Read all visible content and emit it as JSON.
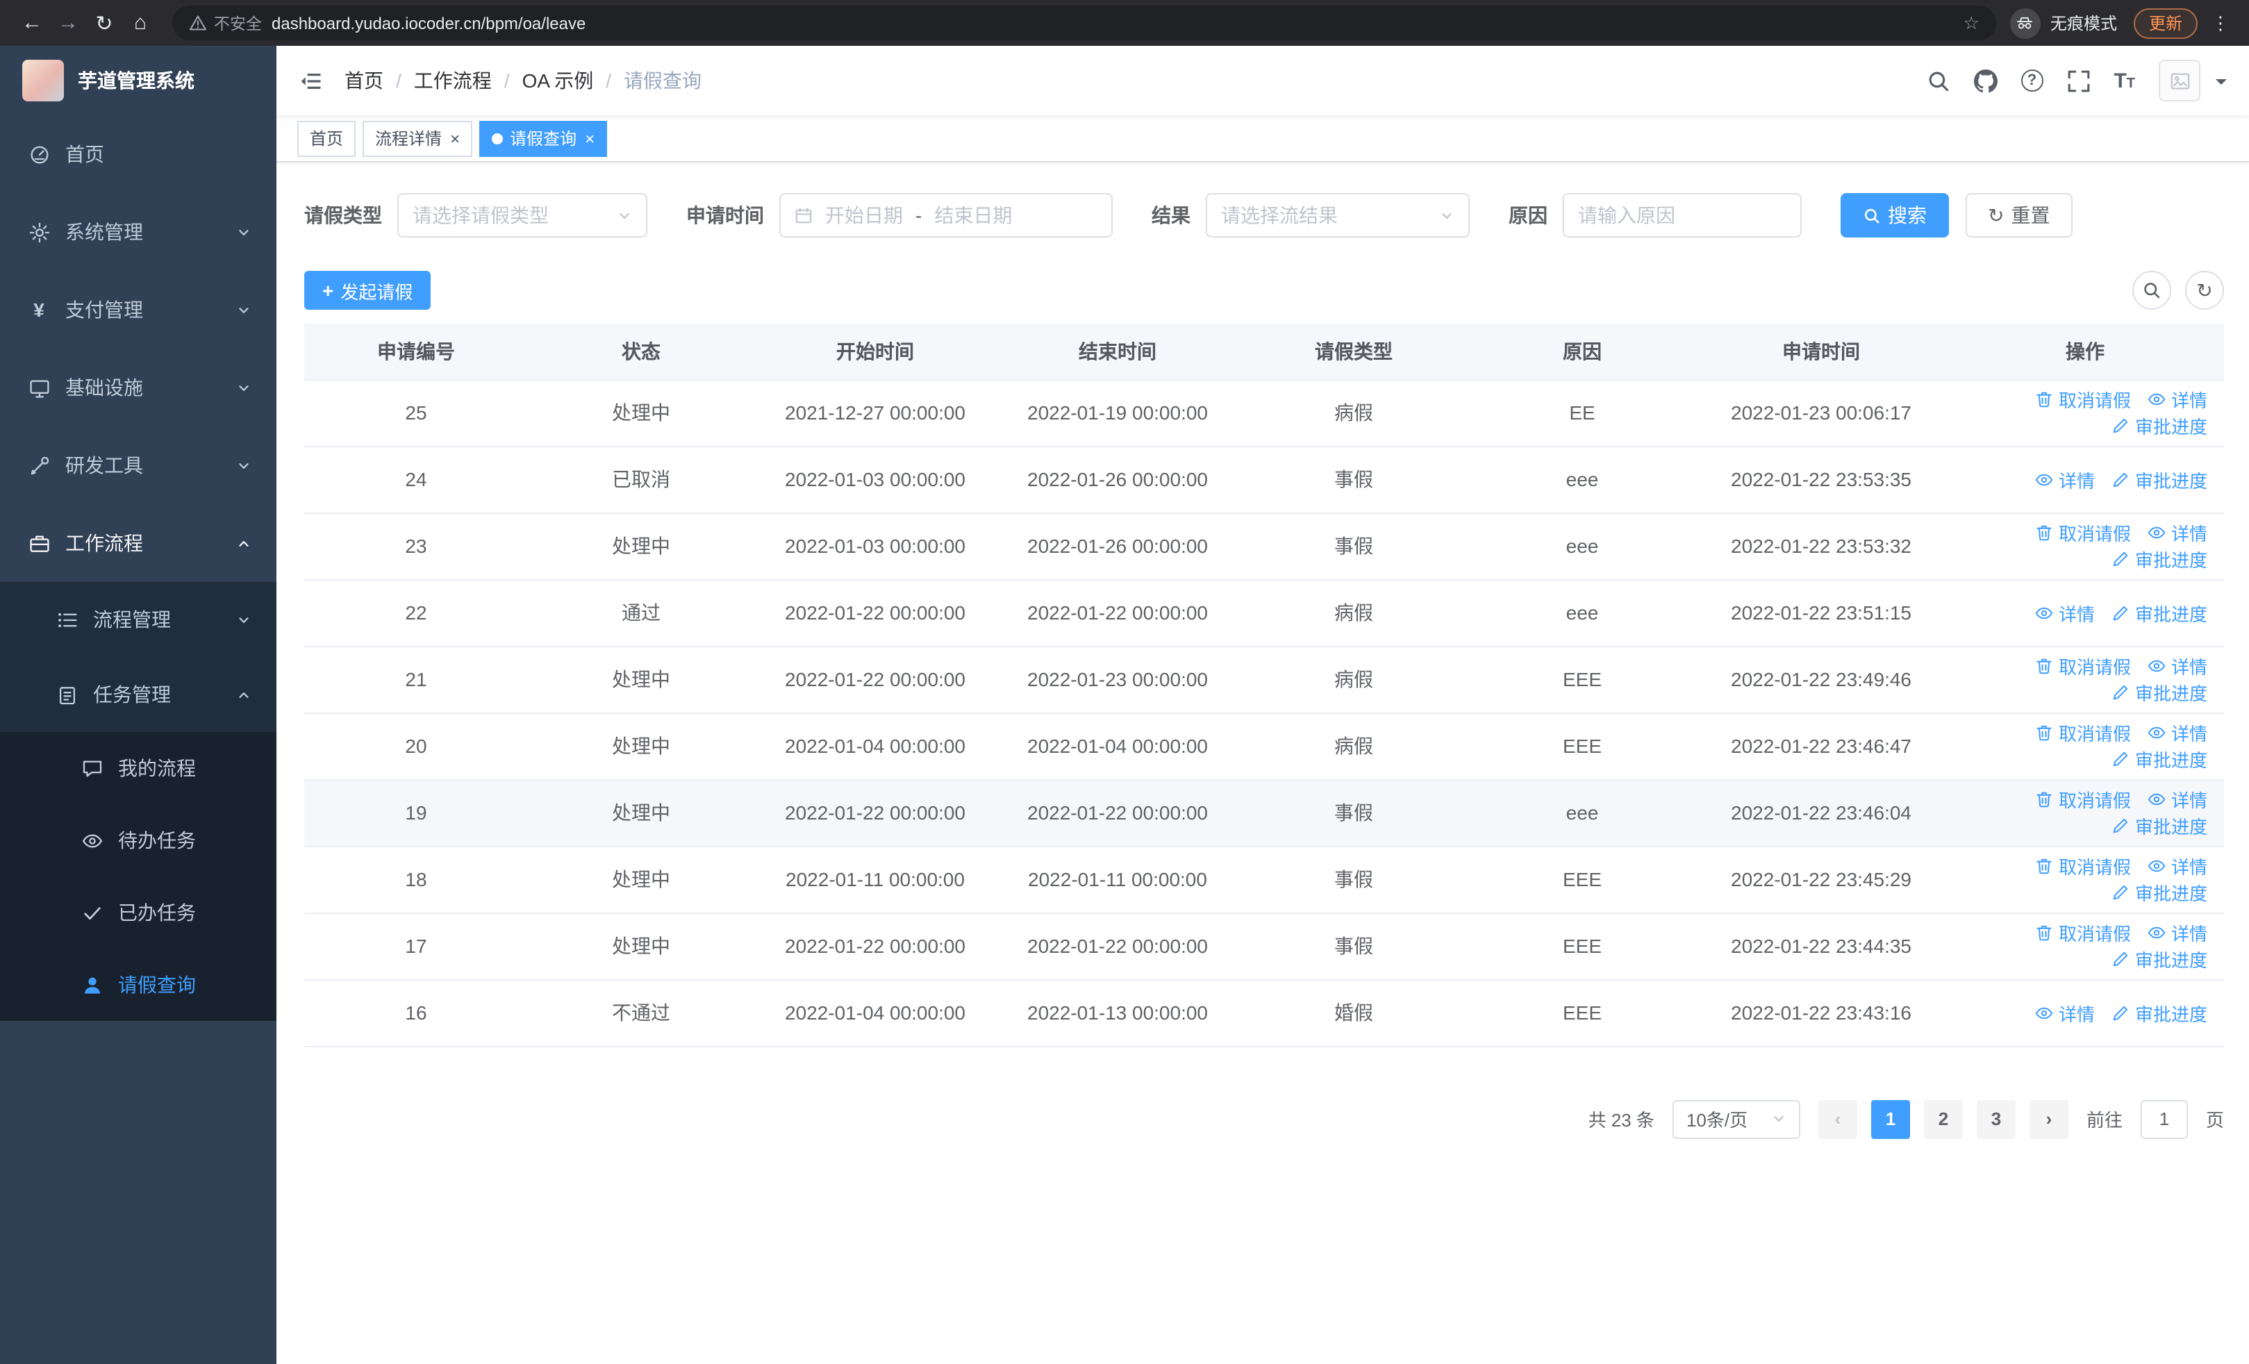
{
  "browser": {
    "security_label": "不安全",
    "url": "dashboard.yudao.iocoder.cn/bpm/oa/leave",
    "incognito_label": "无痕模式",
    "update_label": "更新",
    "icons": [
      "back-icon",
      "forward-icon",
      "refresh-icon",
      "home-icon",
      "warning-icon",
      "star-icon",
      "incognito-icon",
      "menu-dots-icon"
    ]
  },
  "sidebar": {
    "logo_title": "芋道管理系统",
    "items": [
      {
        "label": "首页",
        "icon": "dashboard-icon",
        "level": 1
      },
      {
        "label": "系统管理",
        "icon": "gear-icon",
        "level": 1,
        "expandable": true,
        "expanded": false
      },
      {
        "label": "支付管理",
        "icon": "yen-icon",
        "level": 1,
        "expandable": true,
        "expanded": false
      },
      {
        "label": "基础设施",
        "icon": "monitor-icon",
        "level": 1,
        "expandable": true,
        "expanded": false
      },
      {
        "label": "研发工具",
        "icon": "tool-icon",
        "level": 1,
        "expandable": true,
        "expanded": false
      },
      {
        "label": "工作流程",
        "icon": "briefcase-icon",
        "level": 1,
        "expandable": true,
        "expanded": true
      },
      {
        "label": "流程管理",
        "icon": "list-icon",
        "level": 2,
        "expandable": true,
        "expanded": false
      },
      {
        "label": "任务管理",
        "icon": "clipboard-icon",
        "level": 2,
        "expandable": true,
        "expanded": true
      },
      {
        "label": "我的流程",
        "icon": "chat-icon",
        "level": 3
      },
      {
        "label": "待办任务",
        "icon": "eye-icon",
        "level": 3
      },
      {
        "label": "已办任务",
        "icon": "check-icon",
        "level": 3
      },
      {
        "label": "请假查询",
        "icon": "user-icon",
        "level": 3,
        "active": true
      }
    ]
  },
  "navbar": {
    "breadcrumb": [
      "首页",
      "工作流程",
      "OA 示例",
      "请假查询"
    ],
    "icons": [
      "hamburger-icon",
      "search-icon",
      "github-icon",
      "question-icon",
      "fullscreen-icon",
      "font-size-icon",
      "avatar",
      "caret-down-icon"
    ]
  },
  "tabs": [
    {
      "label": "首页",
      "active": false,
      "closable": false
    },
    {
      "label": "流程详情",
      "active": false,
      "closable": true
    },
    {
      "label": "请假查询",
      "active": true,
      "closable": true
    }
  ],
  "filters": {
    "leave_type": {
      "label": "请假类型",
      "placeholder": "请选择请假类型"
    },
    "apply_time": {
      "label": "申请时间",
      "start_placeholder": "开始日期",
      "separator": "-",
      "end_placeholder": "结束日期"
    },
    "result": {
      "label": "结果",
      "placeholder": "请选择流结果"
    },
    "reason": {
      "label": "原因",
      "placeholder": "请输入原因"
    },
    "search_label": "搜索",
    "reset_label": "重置"
  },
  "toolbar": {
    "create_label": "发起请假"
  },
  "table": {
    "columns": [
      "申请编号",
      "状态",
      "开始时间",
      "结束时间",
      "请假类型",
      "原因",
      "申请时间",
      "操作"
    ],
    "column_keys": [
      "id",
      "status",
      "start",
      "end",
      "type",
      "reason",
      "applied"
    ],
    "action_labels": {
      "cancel": "取消请假",
      "detail": "详情",
      "progress": "审批进度"
    },
    "rows": [
      {
        "id": "25",
        "status": "处理中",
        "start": "2021-12-27 00:00:00",
        "end": "2022-01-19 00:00:00",
        "type": "病假",
        "reason": "EE",
        "applied": "2022-01-23 00:06:17",
        "actions": [
          "cancel",
          "detail",
          "progress"
        ],
        "highlight": false
      },
      {
        "id": "24",
        "status": "已取消",
        "start": "2022-01-03 00:00:00",
        "end": "2022-01-26 00:00:00",
        "type": "事假",
        "reason": "eee",
        "applied": "2022-01-22 23:53:35",
        "actions": [
          "detail",
          "progress"
        ],
        "highlight": false
      },
      {
        "id": "23",
        "status": "处理中",
        "start": "2022-01-03 00:00:00",
        "end": "2022-01-26 00:00:00",
        "type": "事假",
        "reason": "eee",
        "applied": "2022-01-22 23:53:32",
        "actions": [
          "cancel",
          "detail",
          "progress"
        ],
        "highlight": false
      },
      {
        "id": "22",
        "status": "通过",
        "start": "2022-01-22 00:00:00",
        "end": "2022-01-22 00:00:00",
        "type": "病假",
        "reason": "eee",
        "applied": "2022-01-22 23:51:15",
        "actions": [
          "detail",
          "progress"
        ],
        "highlight": false
      },
      {
        "id": "21",
        "status": "处理中",
        "start": "2022-01-22 00:00:00",
        "end": "2022-01-23 00:00:00",
        "type": "病假",
        "reason": "EEE",
        "applied": "2022-01-22 23:49:46",
        "actions": [
          "cancel",
          "detail",
          "progress"
        ],
        "highlight": false
      },
      {
        "id": "20",
        "status": "处理中",
        "start": "2022-01-04 00:00:00",
        "end": "2022-01-04 00:00:00",
        "type": "病假",
        "reason": "EEE",
        "applied": "2022-01-22 23:46:47",
        "actions": [
          "cancel",
          "detail",
          "progress"
        ],
        "highlight": false
      },
      {
        "id": "19",
        "status": "处理中",
        "start": "2022-01-22 00:00:00",
        "end": "2022-01-22 00:00:00",
        "type": "事假",
        "reason": "eee",
        "applied": "2022-01-22 23:46:04",
        "actions": [
          "cancel",
          "detail",
          "progress"
        ],
        "highlight": true
      },
      {
        "id": "18",
        "status": "处理中",
        "start": "2022-01-11 00:00:00",
        "end": "2022-01-11 00:00:00",
        "type": "事假",
        "reason": "EEE",
        "applied": "2022-01-22 23:45:29",
        "actions": [
          "cancel",
          "detail",
          "progress"
        ],
        "highlight": false
      },
      {
        "id": "17",
        "status": "处理中",
        "start": "2022-01-22 00:00:00",
        "end": "2022-01-22 00:00:00",
        "type": "事假",
        "reason": "EEE",
        "applied": "2022-01-22 23:44:35",
        "actions": [
          "cancel",
          "detail",
          "progress"
        ],
        "highlight": false
      },
      {
        "id": "16",
        "status": "不通过",
        "start": "2022-01-04 00:00:00",
        "end": "2022-01-13 00:00:00",
        "type": "婚假",
        "reason": "EEE",
        "applied": "2022-01-22 23:43:16",
        "actions": [
          "detail",
          "progress"
        ],
        "highlight": false
      }
    ]
  },
  "pagination": {
    "total_text": "共 23 条",
    "page_size": "10条/页",
    "pages": [
      "1",
      "2",
      "3"
    ],
    "active_page": "1",
    "goto_prefix": "前往",
    "goto_value": "1",
    "goto_suffix": "页"
  },
  "colors": {
    "primary": "#409eff",
    "sidebar_bg": "#304156",
    "sidebar_submenu_bg": "#1f2d3d",
    "sidebar_text": "#bfcbd9",
    "table_header_bg": "#f5f7fa"
  }
}
